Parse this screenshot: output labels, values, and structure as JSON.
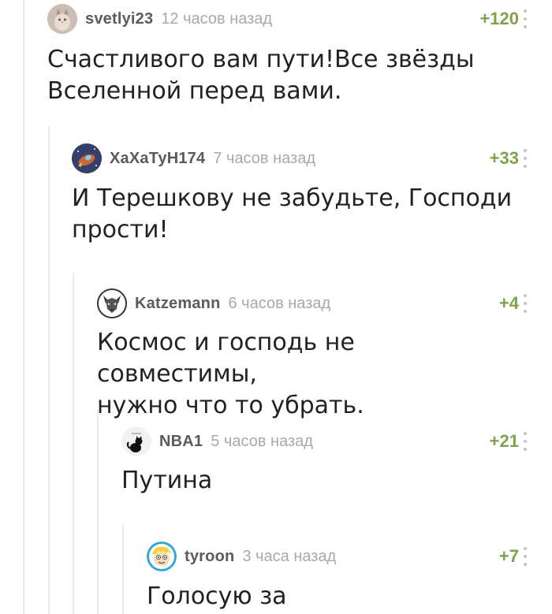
{
  "comments": [
    {
      "username": "svetlyi23",
      "time": "12 часов назад",
      "rating": "+120",
      "text": "Счастливого вам пути!Все звёзды\nВселенной перед вами.",
      "avatar_icon": "cat-photo-avatar"
    },
    {
      "username": "ХаХаТуН174",
      "time": "7 часов назад",
      "rating": "+33",
      "text": "И Терешкову не забудьте, Господи\nпрости!",
      "avatar_icon": "space-ship-avatar"
    },
    {
      "username": "Katzemann",
      "time": "6 часов назад",
      "rating": "+4",
      "text": "Космос и господь не совместимы,\nнужно что то убрать.",
      "avatar_icon": "wolf-mask-avatar"
    },
    {
      "username": "NBA1",
      "time": "5 часов назад",
      "rating": "+21",
      "text": "Путина",
      "avatar_icon": "black-cat-avatar"
    },
    {
      "username": "tyroon",
      "time": "3 часа назад",
      "rating": "+7",
      "text": "Голосую за",
      "avatar_icon": "cartoon-face-avatar"
    }
  ],
  "colors": {
    "rating": "#7fa34a",
    "username": "#5b5b5b",
    "time": "#a9a9a9",
    "thread_line": "#ececec"
  }
}
